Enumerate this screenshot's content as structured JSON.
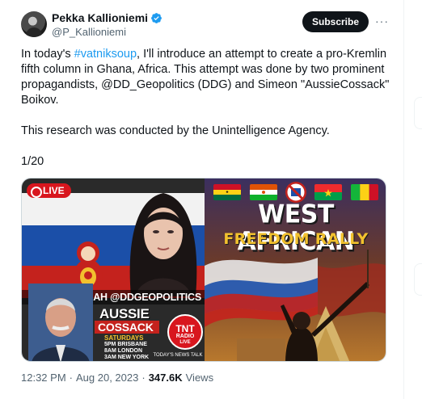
{
  "author": {
    "name": "Pekka Kallioniemi",
    "handle": "@P_Kallioniemi",
    "verified": true
  },
  "actions": {
    "subscribe_label": "Subscribe",
    "more_label": "···"
  },
  "tweet": {
    "line1_pre": "In today's ",
    "hashtag": "#vatniksoup",
    "line1_post": ", I'll introduce an attempt to create a pro-Kremlin fifth column in Ghana, Africa. This attempt was done by two prominent propagandists, @DD_Geopolitics (DDG) and Simeon \"AussieCossack\" Boikov.",
    "line2": "This research was conducted by the Unintelligence Agency.",
    "line3": "1/20"
  },
  "media": {
    "left": {
      "live_label": "LIVE",
      "name_banner": "SARAH @DDGEOPOLITICS",
      "show_title_1": "AUSSIE",
      "show_title_2": "COSSACK",
      "schedule_day": "SATURDAYS",
      "schedule_1": "5PM BRISBANE",
      "schedule_2": "8AM LONDON",
      "schedule_3": "3AM NEW YORK",
      "station_logo": "TNT",
      "station_logo_sub": "RADIO",
      "station_logo_live": "LIVE",
      "station_tagline": "TODAY'S NEWS TALK"
    },
    "right": {
      "headline_1": "WEST AFRICAN",
      "headline_2": "FREEDOM RALLY"
    }
  },
  "meta": {
    "time": "12:32 PM",
    "separator": "·",
    "date": "Aug 20, 2023",
    "views_count": "347.6K",
    "views_label": "Views"
  },
  "colors": {
    "link": "#1d9bf0",
    "verified": "#1d9bf0",
    "button_bg": "#0f1419",
    "muted_text": "#536471"
  }
}
